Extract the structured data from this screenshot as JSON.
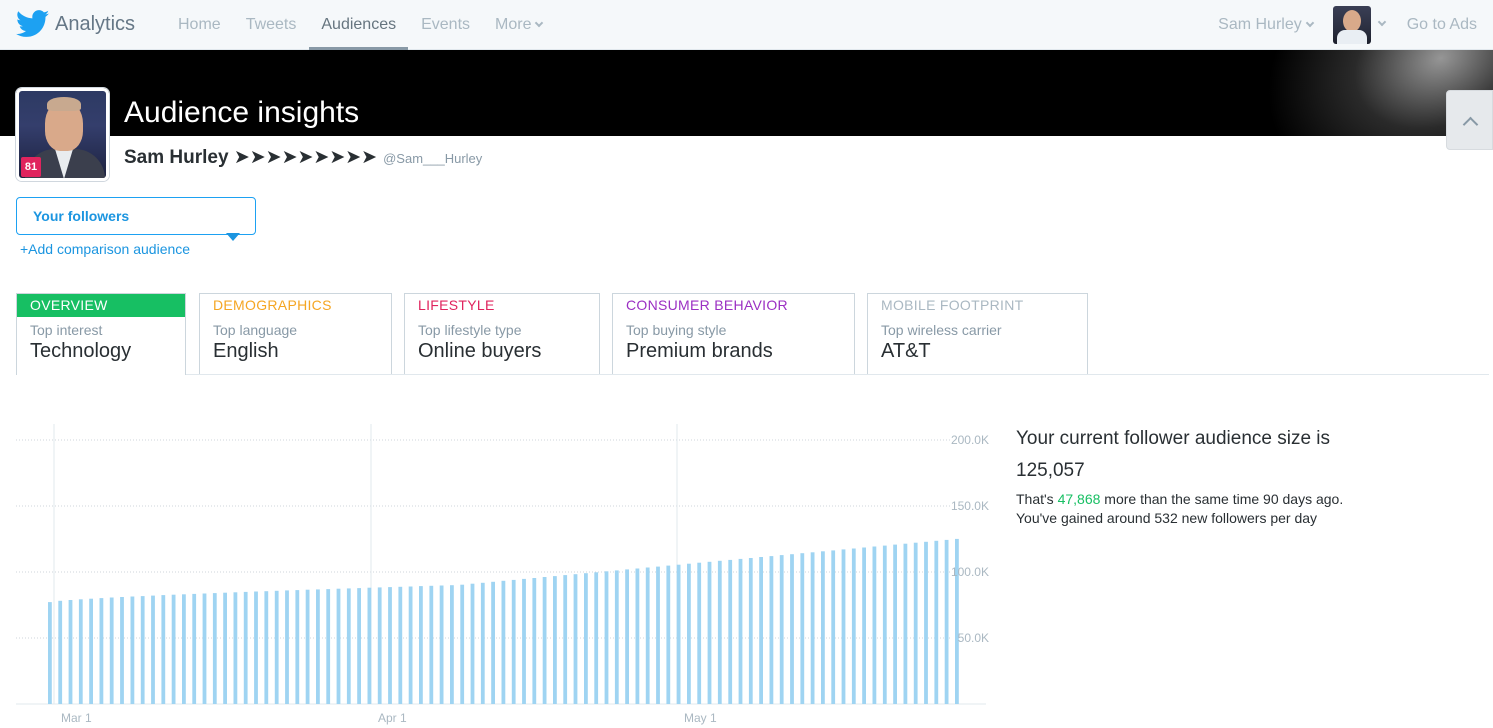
{
  "nav": {
    "brand": "Analytics",
    "links": [
      "Home",
      "Tweets",
      "Audiences",
      "Events",
      "More"
    ],
    "active": "Audiences",
    "user": "Sam Hurley",
    "go_to_ads": "Go to Ads"
  },
  "header": {
    "title": "Audience insights",
    "name": "Sam Hurley ➤➤➤➤➤➤➤➤➤",
    "handle": "@Sam___Hurley",
    "badge": "81"
  },
  "audience": {
    "selected": "Your followers",
    "add_comparison": "+Add comparison audience"
  },
  "tabs": [
    {
      "label": "OVERVIEW",
      "sub": "Top interest",
      "value": "Technology",
      "color": "#17bf63",
      "active": true
    },
    {
      "label": "DEMOGRAPHICS",
      "sub": "Top language",
      "value": "English",
      "color": "#f5a623",
      "active": false
    },
    {
      "label": "LIFESTYLE",
      "sub": "Top lifestyle type",
      "value": "Online buyers",
      "color": "#e0245e",
      "active": false
    },
    {
      "label": "CONSUMER BEHAVIOR",
      "sub": "Top buying style",
      "value": "Premium brands",
      "color": "#9b2fc3",
      "active": false
    },
    {
      "label": "MOBILE FOOTPRINT",
      "sub": "Top wireless carrier",
      "value": "AT&T",
      "color": "#aab8c2",
      "active": false
    }
  ],
  "summary": {
    "title": "Your current follower audience size is",
    "count": "125,057",
    "line1_prefix": "That's ",
    "line1_highlight": "47,868",
    "line1_suffix": " more than the same time 90 days ago.",
    "line2": "You've gained around 532 new followers per day",
    "highlight_color": "#17bf63"
  },
  "chart_data": {
    "type": "bar",
    "y_ticks": [
      "200.0K",
      "150.0K",
      "100.0K",
      "50.0K"
    ],
    "ylim": [
      0,
      200000
    ],
    "x_ticks": [
      "Mar 1",
      "Apr 1",
      "May 1"
    ],
    "bar_color": "#9fd4f2",
    "start_value": 77200,
    "end_value": 125057,
    "bar_count": 89
  }
}
